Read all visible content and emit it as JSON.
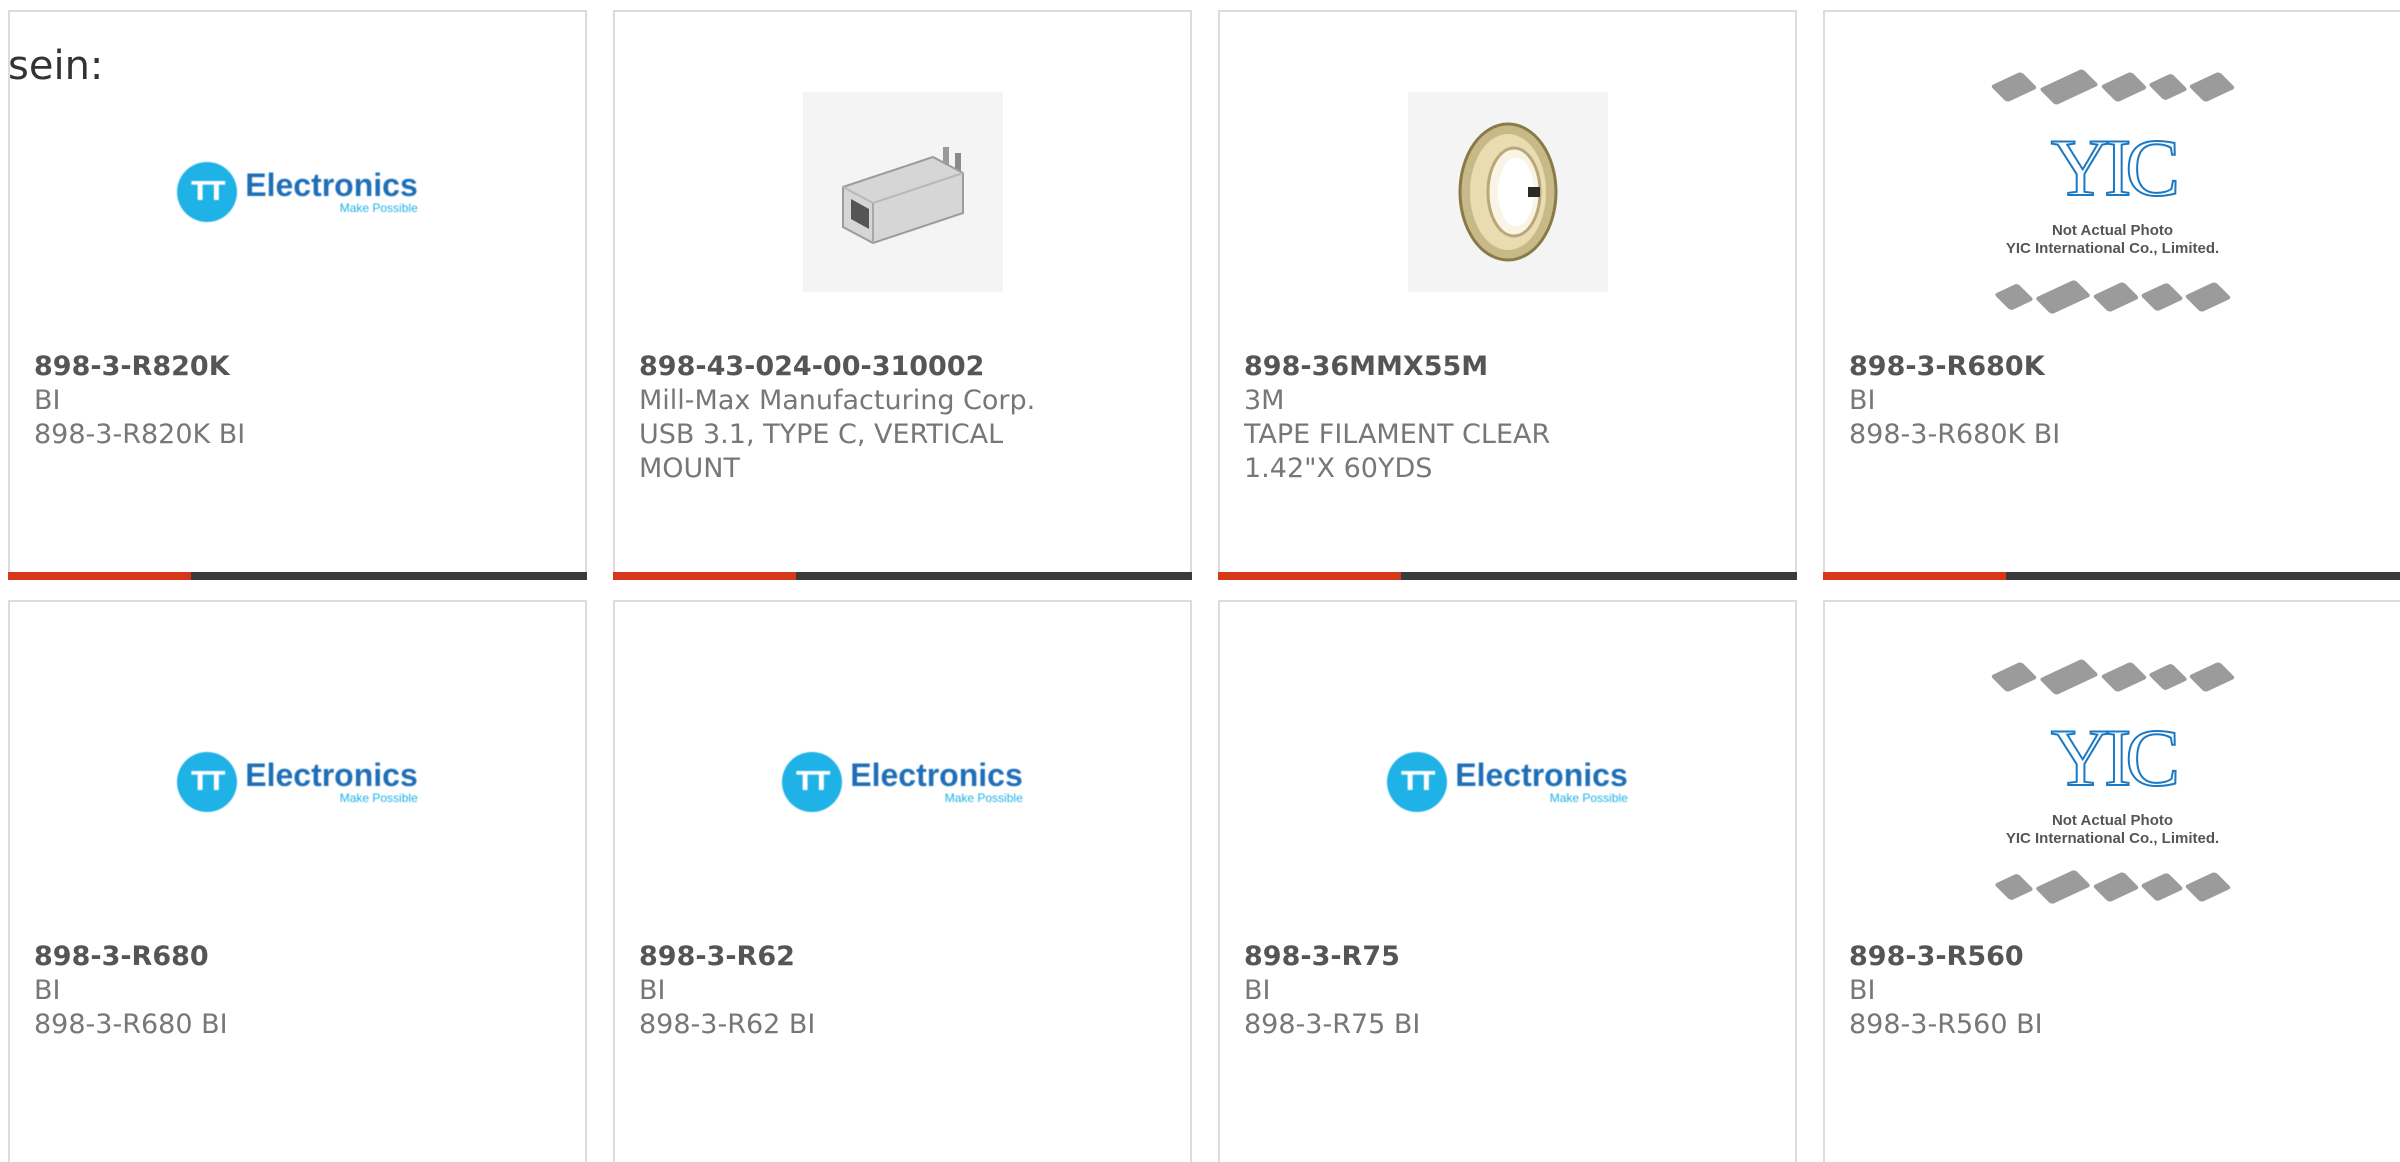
{
  "intro_text": "sein:",
  "colors": {
    "accent": "#d8381a",
    "bar_dark": "#3a3a3a",
    "tt_blue": "#1eb2e6",
    "yic_blue": "#1b79c4"
  },
  "tt_logo": {
    "initials": "TT",
    "name": "Electronics",
    "tagline": "Make Possible"
  },
  "yic_logo": {
    "mark": "YIC",
    "caption_line1": "Not Actual Photo",
    "caption_line2": "YIC International Co., Limited."
  },
  "products": [
    {
      "part_number": "898-3-R820K",
      "manufacturer": "BI",
      "description": "898-3-R820K BI",
      "image": "tt-electronics-logo"
    },
    {
      "part_number": "898-43-024-00-310002",
      "manufacturer": "Mill-Max Manufacturing Corp.",
      "description": "USB 3.1, TYPE C, VERTICAL MOUNT",
      "image": "usb-c-connector-photo"
    },
    {
      "part_number": "898-36MMX55M",
      "manufacturer": "3M",
      "description": "TAPE FILAMENT CLEAR 1.42\"X 60YDS",
      "image": "tape-roll-photo"
    },
    {
      "part_number": "898-3-R680K",
      "manufacturer": "BI",
      "description": "898-3-R680K BI",
      "image": "yic-placeholder"
    },
    {
      "part_number": "898-3-R680",
      "manufacturer": "BI",
      "description": "898-3-R680 BI",
      "image": "tt-electronics-logo"
    },
    {
      "part_number": "898-3-R62",
      "manufacturer": "BI",
      "description": "898-3-R62 BI",
      "image": "tt-electronics-logo"
    },
    {
      "part_number": "898-3-R75",
      "manufacturer": "BI",
      "description": "898-3-R75 BI",
      "image": "tt-electronics-logo"
    },
    {
      "part_number": "898-3-R560",
      "manufacturer": "BI",
      "description": "898-3-R560 BI",
      "image": "yic-placeholder"
    }
  ]
}
